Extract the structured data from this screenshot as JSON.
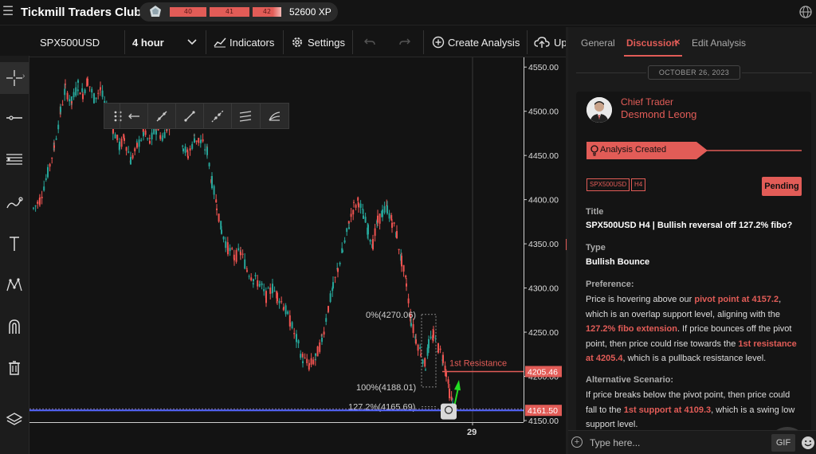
{
  "app": {
    "title": "Tickmill Traders Club"
  },
  "xp": {
    "levels": [
      "40",
      "41",
      "42"
    ],
    "label": "52600 XP"
  },
  "toolbar": {
    "symbol": "SPX500USD",
    "interval": "4 hour",
    "indicators": "Indicators",
    "settings": "Settings",
    "create": "Create Analysis",
    "upload": "Up"
  },
  "chart_data": {
    "type": "candlestick",
    "y_ticks": [
      "4550.00",
      "4500.00",
      "4450.00",
      "4400.00",
      "4350.00",
      "4300.00",
      "4250.00",
      "4200.00",
      "4150.00"
    ],
    "ylim": [
      4150,
      4552
    ],
    "x_tick": "29",
    "fib": {
      "level_0": "0%(4270.06)",
      "level_100": "100%(4188.01)",
      "level_127": "127.2%(4165.69)"
    },
    "resistance_label": "1st Resistance",
    "price_labels": [
      "4205.46",
      "4161.50"
    ],
    "price_values": [
      4205.46,
      4161.5
    ],
    "colors": {
      "up": "#26a69a",
      "down": "#ef5350",
      "line": "#e25c57",
      "support": "#5566ff"
    }
  },
  "panel": {
    "tabs": [
      "General",
      "Discussion",
      "Edit Analysis"
    ],
    "close_icon": "×",
    "date": "OCTOBER 26, 2023",
    "author_role": "Chief Trader",
    "author_name": "Desmond Leong",
    "ribbon": "Analysis Created",
    "tags": [
      "SPX500USD",
      "H4"
    ],
    "status": "Pending",
    "title_label": "Title",
    "title_value": "SPX500USD H4 | Bullish reversal off 127.2% fibo?",
    "type_label": "Type",
    "type_value": "Bullish Bounce",
    "pref_label": "Preference:",
    "pref_1": "Price is hovering above our ",
    "pref_hl1": "pivot point at 4157.2",
    "pref_2": ", which is an overlap support level, aligning with the ",
    "pref_hl2": "127.2% fibo extension",
    "pref_3": ". If price bounces off the pivot point, then price could rise towards the ",
    "pref_hl3": "1st resistance at 4205.4",
    "pref_4": ", which is a pullback resistance level.",
    "alt_label": "Alternative Scenario:",
    "alt_1": "If price breaks below the pivot point, then price could fall to the ",
    "alt_hl1": "1st support at 4109.3",
    "alt_2": ", which is a swing low support level.",
    "composer_placeholder": "Type here...",
    "gif": "GIF"
  }
}
